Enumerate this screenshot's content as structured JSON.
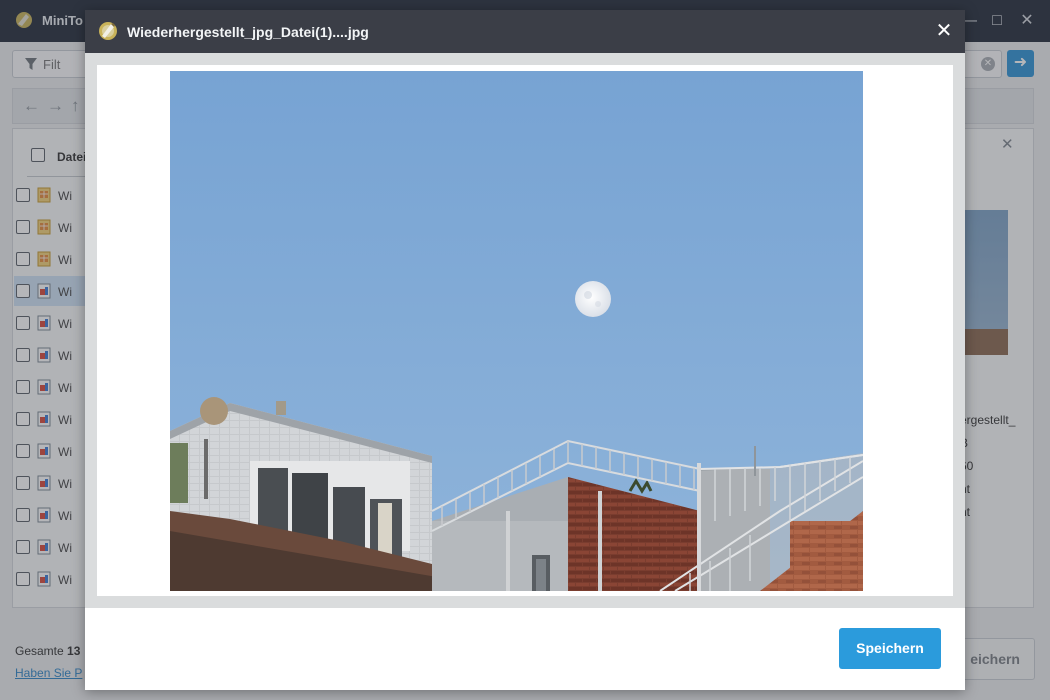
{
  "app": {
    "title": "MiniTo",
    "window_controls": [
      "minimize-icon",
      "maximize-icon",
      "close-icon"
    ]
  },
  "filter": {
    "label": "Filt"
  },
  "list": {
    "header_label": "Datei",
    "rows": [
      {
        "name": "Wi",
        "icon": "jpg-file-icon",
        "selected": false
      },
      {
        "name": "Wi",
        "icon": "jpg-file-icon",
        "selected": false
      },
      {
        "name": "Wi",
        "icon": "jpg-file-icon",
        "selected": false
      },
      {
        "name": "Wi",
        "icon": "doc-file-icon",
        "selected": true
      },
      {
        "name": "Wi",
        "icon": "doc-file-icon",
        "selected": false
      },
      {
        "name": "Wi",
        "icon": "doc-file-icon",
        "selected": false
      },
      {
        "name": "Wi",
        "icon": "doc-file-icon",
        "selected": false
      },
      {
        "name": "Wi",
        "icon": "doc-file-icon",
        "selected": false
      },
      {
        "name": "Wi",
        "icon": "doc-file-icon",
        "selected": false
      },
      {
        "name": "Wi",
        "icon": "doc-file-icon",
        "selected": false
      },
      {
        "name": "Wi",
        "icon": "doc-file-icon",
        "selected": false
      },
      {
        "name": "Wi",
        "icon": "doc-file-icon",
        "selected": false
      },
      {
        "name": "Wi",
        "icon": "doc-file-icon",
        "selected": false
      }
    ]
  },
  "side_panel": {
    "lines": [
      "ergestellt_",
      "B",
      "60",
      "nt",
      "nt"
    ]
  },
  "footer": {
    "total_label": "Gesamte",
    "total_count": "13",
    "help_link": "Haben Sie P",
    "save_ghost": "eichern"
  },
  "modal": {
    "title": "Wiederhergestellt_jpg_Datei(1)....jpg",
    "close_icon": "close-icon",
    "save_label": "Speichern"
  },
  "colors": {
    "accent": "#2b9bdc",
    "titlebar": "#3b3e47",
    "sky": "#7ba6d6"
  }
}
